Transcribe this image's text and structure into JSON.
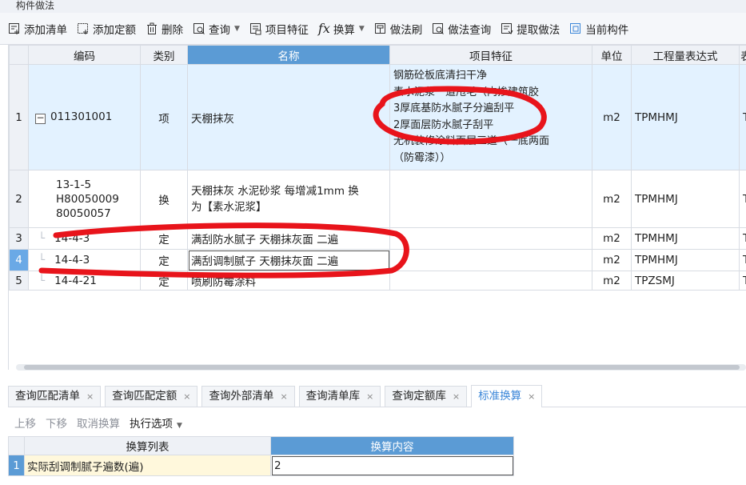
{
  "panel_title": "构件做法",
  "toolbar": {
    "add_bill": "添加清单",
    "add_quota": "添加定额",
    "delete": "删除",
    "query": "查询",
    "item_feature": "项目特征",
    "convert_symbol": "fx",
    "convert": "换算",
    "method_brush": "做法刷",
    "method_query": "做法查询",
    "extract_method": "提取做法",
    "current_component": "当前构件"
  },
  "grid": {
    "headers": {
      "code": "编码",
      "category": "类别",
      "name": "名称",
      "feature": "项目特征",
      "unit": "单位",
      "expr": "工程量表达式",
      "next": "表"
    },
    "rows": [
      {
        "no": "1",
        "code": "011301001",
        "category": "项",
        "name": "天棚抹灰",
        "feature_lines": [
          "钢筋砼板底清扫干净",
          "素水泥浆一道甩毛（内掺建筑胶",
          "3厚底基防水腻子分遍刮平",
          "2厚面层防水腻子刮平",
          "无机装修涂料面层三道（一底两面",
          "（防霉漆））"
        ],
        "unit": "m2",
        "expr": "TPMHMJ",
        "next": "TI"
      },
      {
        "no": "2",
        "code_lines": [
          "13-1-5",
          "H80050009",
          "80050057"
        ],
        "category": "换",
        "name_lines": [
          "天棚抹灰 水泥砂浆 每增减1mm  换",
          "为【素水泥浆】"
        ],
        "unit": "m2",
        "expr": "TPMHMJ",
        "next": "TI"
      },
      {
        "no": "3",
        "code": "14-4-3",
        "category": "定",
        "name": "满刮防水腻子 天棚抹灰面 二遍",
        "unit": "m2",
        "expr": "TPMHMJ",
        "next": "TI"
      },
      {
        "no": "4",
        "code": "14-4-3",
        "category": "定",
        "name": "满刮调制腻子 天棚抹灰面 二遍",
        "unit": "m2",
        "expr": "TPMHMJ",
        "next": "TI"
      },
      {
        "no": "5",
        "code": "14-4-21",
        "category": "定",
        "name": "喷刷防霉涂料",
        "unit": "m2",
        "expr": "TPZSMJ",
        "next": "TI"
      }
    ]
  },
  "tabs": [
    {
      "label": "查询匹配清单",
      "close": "×"
    },
    {
      "label": "查询匹配定额",
      "close": "×"
    },
    {
      "label": "查询外部清单",
      "close": "×"
    },
    {
      "label": "查询清单库",
      "close": "×"
    },
    {
      "label": "查询定额库",
      "close": "×"
    },
    {
      "label": "标准换算",
      "close": "×"
    }
  ],
  "subtoolbar": {
    "move_up": "上移",
    "move_down": "下移",
    "cancel_convert": "取消换算",
    "exec_options": "执行选项"
  },
  "calc_table": {
    "headers": {
      "list": "换算列表",
      "content": "换算内容"
    },
    "rows": [
      {
        "no": "1",
        "name": "实际刮调制腻子遍数(遍)",
        "value": "2"
      }
    ]
  },
  "colors": {
    "header_highlight": "#5b9bd5",
    "selected_row_bg": "#e3f2ff",
    "annotation_red": "#e8141b",
    "active_tab_text": "#3b86d8"
  }
}
